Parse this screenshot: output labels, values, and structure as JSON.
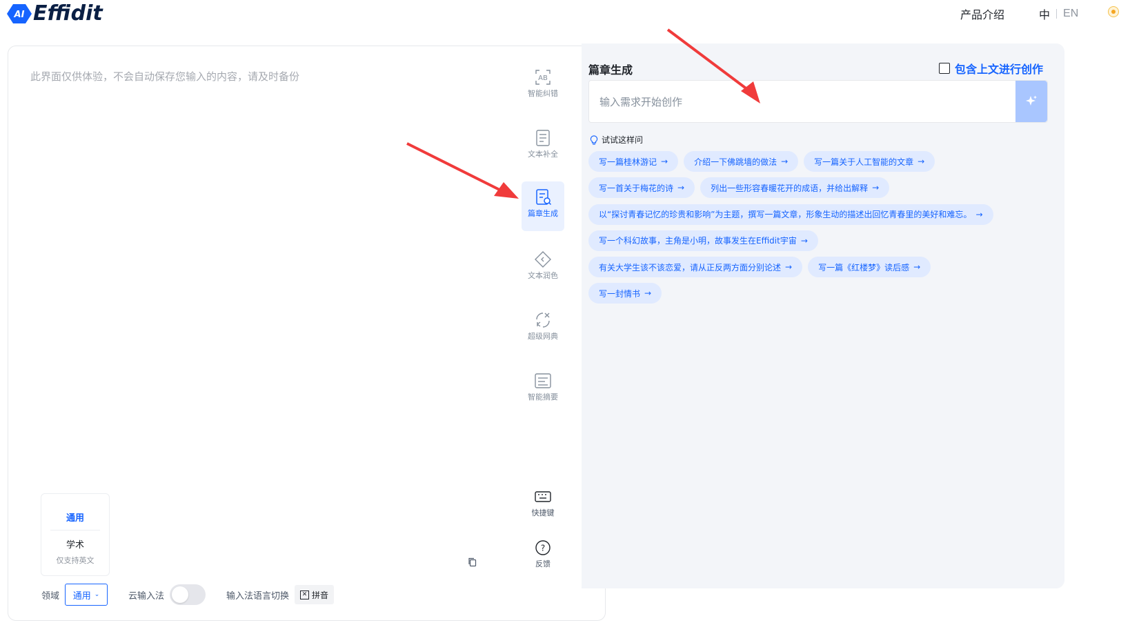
{
  "header": {
    "logo_badge": "AI",
    "logo_text": "Effidit",
    "product_intro": "产品介绍",
    "lang_zh": "中",
    "lang_en": "EN"
  },
  "editor": {
    "placeholder": "此界面仅供体验，不会自动保存您输入的内容，请及时备份",
    "domain_popup": {
      "general": "通用",
      "academic": "学术",
      "academic_note": "仅支持英文"
    },
    "bottom": {
      "domain_label": "领域",
      "domain_value": "通用",
      "cloud_ime_label": "云输入法",
      "ime_switch_label": "输入法语言切换",
      "ime_value": "拼音"
    }
  },
  "tools": [
    {
      "label": "智能纠错",
      "icon": "ab-check-icon"
    },
    {
      "label": "文本补全",
      "icon": "doc-complete-icon"
    },
    {
      "label": "篇章生成",
      "icon": "article-gen-icon",
      "active": true
    },
    {
      "label": "文本润色",
      "icon": "polish-icon"
    },
    {
      "label": "超级网典",
      "icon": "dictionary-icon"
    },
    {
      "label": "智能摘要",
      "icon": "summary-icon"
    },
    {
      "label": "快捷键",
      "icon": "keyboard-icon"
    },
    {
      "label": "反馈",
      "icon": "help-icon"
    }
  ],
  "panel": {
    "title": "篇章生成",
    "include_context": "包含上文进行创作",
    "prompt_placeholder": "输入需求开始创作",
    "try_label": "试试这样问",
    "suggestions": [
      [
        "写一篇桂林游记",
        "介绍一下佛跳墙的做法",
        "写一篇关于人工智能的文章"
      ],
      [
        "写一首关于梅花的诗",
        "列出一些形容春暖花开的成语，并给出解释"
      ],
      [
        "以“探讨青春记忆的珍贵和影响”为主题，撰写一篇文章，形象生动的描述出回忆青春里的美好和难忘。"
      ],
      [
        "写一个科幻故事，主角是小明，故事发生在Effidit宇宙"
      ],
      [
        "有关大学生该不该恋爱，请从正反两方面分别论述",
        "写一篇《红楼梦》读后感"
      ],
      [
        "写一封情书"
      ]
    ]
  },
  "colors": {
    "accent": "#1664ff",
    "chip_bg": "#e0eaff",
    "panel_bg": "#f3f5f9"
  }
}
